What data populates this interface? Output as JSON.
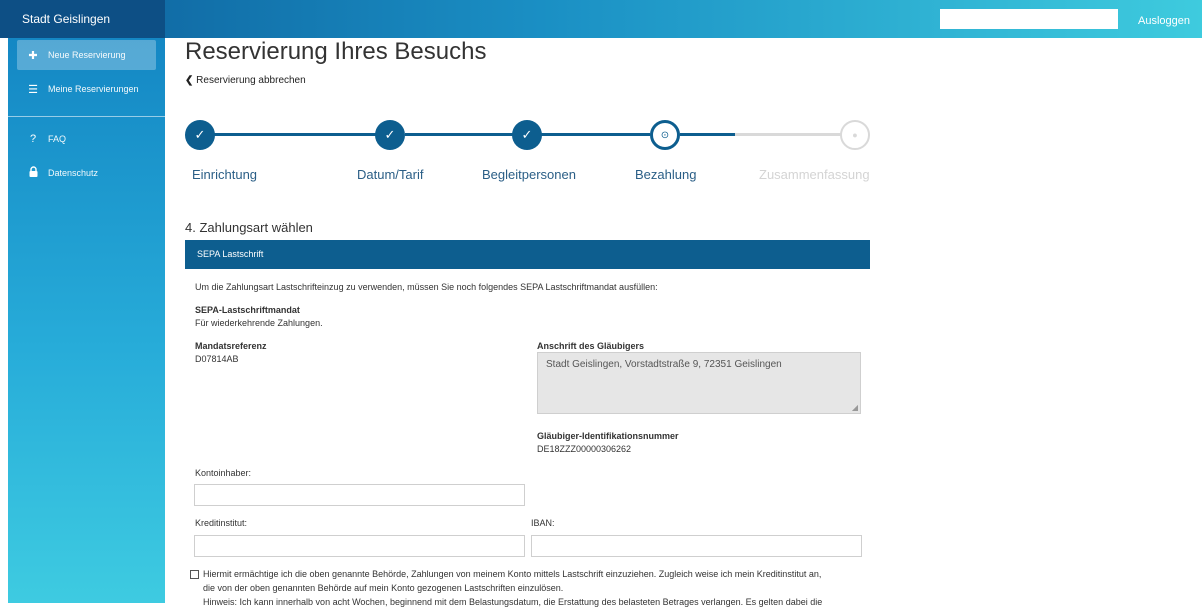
{
  "header": {
    "brand": "Stadt Geislingen",
    "logout_label": "Ausloggen"
  },
  "sidebar": {
    "items": [
      {
        "label": "Neue Reservierung",
        "icon": "plus-icon"
      },
      {
        "label": "Meine Reservierungen",
        "icon": "list-icon"
      },
      {
        "label": "FAQ",
        "icon": "question-icon"
      },
      {
        "label": "Datenschutz",
        "icon": "lock-icon"
      }
    ]
  },
  "main": {
    "title": "Reservierung Ihres Besuchs",
    "cancel_link": "Reservierung abbrechen",
    "steps": [
      {
        "label": "Einrichtung",
        "state": "done"
      },
      {
        "label": "Datum/Tarif",
        "state": "done"
      },
      {
        "label": "Begleitpersonen",
        "state": "done"
      },
      {
        "label": "Bezahlung",
        "state": "current"
      },
      {
        "label": "Zusammenfassung",
        "state": "todo"
      }
    ],
    "section_title": "4. Zahlungsart wählen",
    "panel_title": "SEPA Lastschrift",
    "intro": "Um die Zahlungsart Lastschrifteinzug zu verwenden, müssen Sie noch folgendes SEPA Lastschriftmandat ausfüllen:",
    "mandate_title": "SEPA-Lastschriftmandat",
    "mandate_sub": "Für wiederkehrende Zahlungen.",
    "mandate_ref_label": "Mandatsreferenz",
    "mandate_ref_value": "D07814AB",
    "creditor_address_label": "Anschrift des Gläubigers",
    "creditor_address_value": "Stadt Geislingen, Vorstadtstraße 9, 72351 Geislingen",
    "creditor_id_label": "Gläubiger-Identifikationsnummer",
    "creditor_id_value": "DE18ZZZ00000306262",
    "account_holder_label": "Kontoinhaber:",
    "account_holder_value": "",
    "bank_label": "Kreditinstitut:",
    "bank_value": "",
    "iban_label": "IBAN:",
    "iban_value": "",
    "consent_line1": "Hiermit ermächtige ich die oben genannte Behörde, Zahlungen von meinem Konto mittels Lastschrift einzuziehen. Zugleich weise ich mein Kreditinstitut an,",
    "consent_line2": "die von der oben genannten Behörde auf mein Konto gezogenen Lastschriften einzulösen.",
    "consent_line3": "Hinweis: Ich kann innerhalb von acht Wochen, beginnend mit dem Belastungsdatum, die Erstattung des belasteten Betrages verlangen. Es gelten dabei die"
  },
  "colors": {
    "primary": "#0d5e8f",
    "sidebar_top": "#1487c4",
    "sidebar_bottom": "#3ecbe1",
    "step_todo": "#d9d9d9"
  }
}
